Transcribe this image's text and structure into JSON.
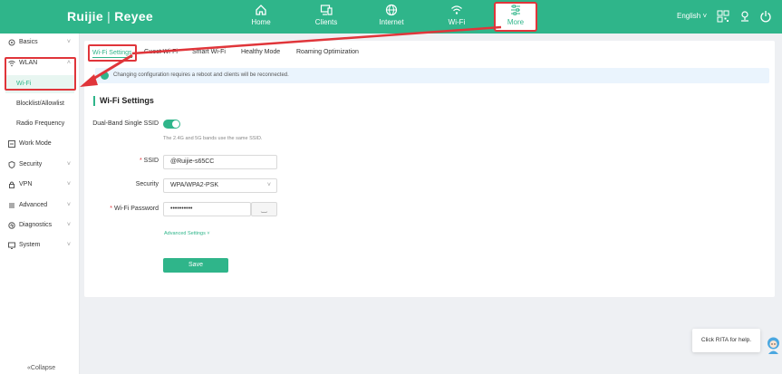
{
  "brand": {
    "logo": "Ruijie",
    "sub": "Reyee"
  },
  "topnav": [
    {
      "label": "Home",
      "icon": "home-icon"
    },
    {
      "label": "Clients",
      "icon": "clients-icon"
    },
    {
      "label": "Internet",
      "icon": "globe-icon"
    },
    {
      "label": "Wi-Fi",
      "icon": "wifi-icon"
    },
    {
      "label": "More",
      "icon": "settings-sliders-icon"
    }
  ],
  "header": {
    "language": "English"
  },
  "sidebar": {
    "items": [
      {
        "label": "Basics",
        "icon": "gear-icon"
      },
      {
        "label": "WLAN",
        "icon": "wifi-icon"
      },
      {
        "label": "Wi-Fi"
      },
      {
        "label": "Blocklist/Allowlist"
      },
      {
        "label": "Radio Frequency"
      },
      {
        "label": "Work Mode",
        "icon": "work-mode-icon"
      },
      {
        "label": "Security",
        "icon": "shield-icon"
      },
      {
        "label": "VPN",
        "icon": "vpn-icon"
      },
      {
        "label": "Advanced",
        "icon": "advanced-icon"
      },
      {
        "label": "Diagnostics",
        "icon": "diagnostics-icon"
      },
      {
        "label": "System",
        "icon": "system-icon"
      }
    ],
    "collapse": "Collapse"
  },
  "tabs": [
    "Wi-Fi Settings",
    "Guest Wi-Fi",
    "Smart Wi-Fi",
    "Healthy Mode",
    "Roaming Optimization"
  ],
  "notice": "Changing configuration requires a reboot and clients will be reconnected.",
  "form": {
    "title": "Wi-Fi Settings",
    "dual_band_label": "Dual-Band Single SSID",
    "dual_band_hint": "The 2.4G and 5G bands use the same SSID.",
    "ssid_label": "SSID",
    "ssid_value": "@Ruijie-s65CC",
    "security_label": "Security",
    "security_value": "WPA/WPA2-PSK",
    "password_label": "Wi-Fi Password",
    "password_value": "••••••••••",
    "advanced": "Advanced Settings ˅",
    "save": "Save"
  },
  "help": {
    "text": "Click RITA for help."
  },
  "colors": {
    "brand": "#2fb58a",
    "annotation": "#e0353a"
  }
}
